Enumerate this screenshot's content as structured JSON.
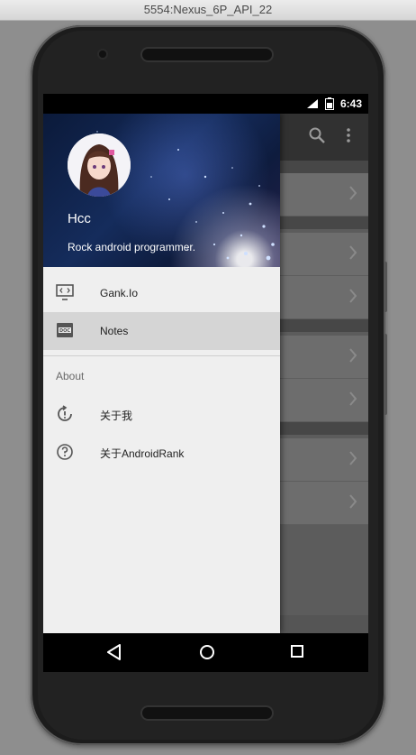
{
  "window": {
    "title": "5554:Nexus_6P_API_22"
  },
  "status_bar": {
    "time": "6:43"
  },
  "drawer": {
    "header": {
      "username": "Hcc",
      "bio": "Rock android programmer."
    },
    "items": [
      {
        "label": "Gank.Io",
        "icon": "code-monitor-icon",
        "selected": false
      },
      {
        "label": "Notes",
        "icon": "doc-icon",
        "selected": true
      }
    ],
    "section_title": "About",
    "about_items": [
      {
        "label": "关于我",
        "icon": "info-refresh-icon"
      },
      {
        "label": "关于AndroidRank",
        "icon": "help-circle-icon"
      }
    ]
  },
  "colors": {
    "drawer_bg": "#efefef",
    "selected_bg": "#d5d5d5",
    "appbar": "#313131"
  }
}
